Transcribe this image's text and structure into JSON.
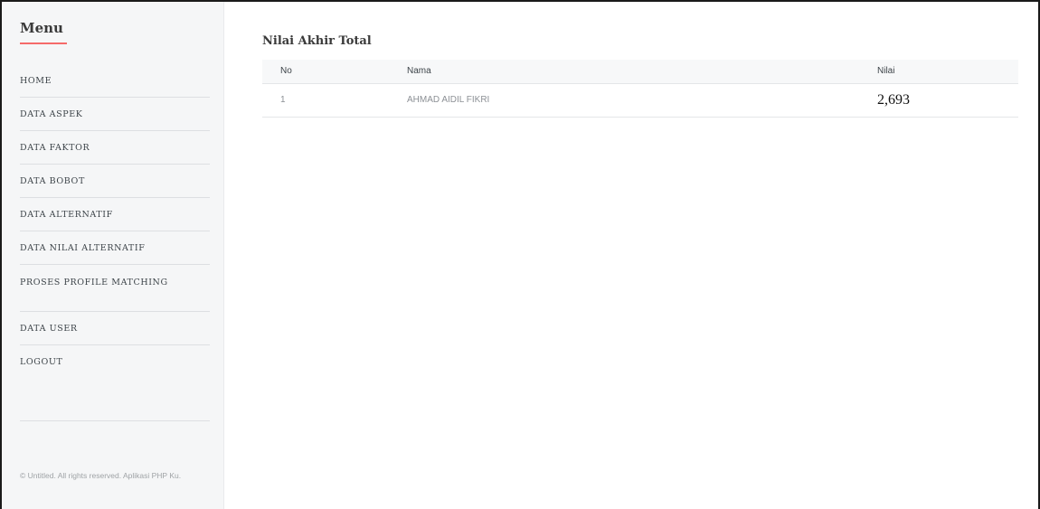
{
  "sidebar": {
    "title": "Menu",
    "items": [
      {
        "label": "HOME"
      },
      {
        "label": "DATA ASPEK"
      },
      {
        "label": "DATA FAKTOR"
      },
      {
        "label": "DATA BOBOT"
      },
      {
        "label": "DATA ALTERNATIF"
      },
      {
        "label": "DATA NILAI ALTERNATIF"
      },
      {
        "label": "PROSES PROFILE MATCHING"
      },
      {
        "label": "DATA USER"
      },
      {
        "label": "LOGOUT"
      }
    ],
    "footer": "© Untitled. All rights reserved. Aplikasi PHP Ku."
  },
  "main": {
    "title": "Nilai Akhir Total",
    "table": {
      "headers": [
        "No",
        "Nama",
        "Nilai"
      ],
      "rows": [
        [
          "1",
          "AHMAD AIDIL FIKRI",
          "2,693"
        ]
      ]
    }
  },
  "colors": {
    "accent": "#f56a6a",
    "sidebar_bg": "#f5f6f7"
  }
}
